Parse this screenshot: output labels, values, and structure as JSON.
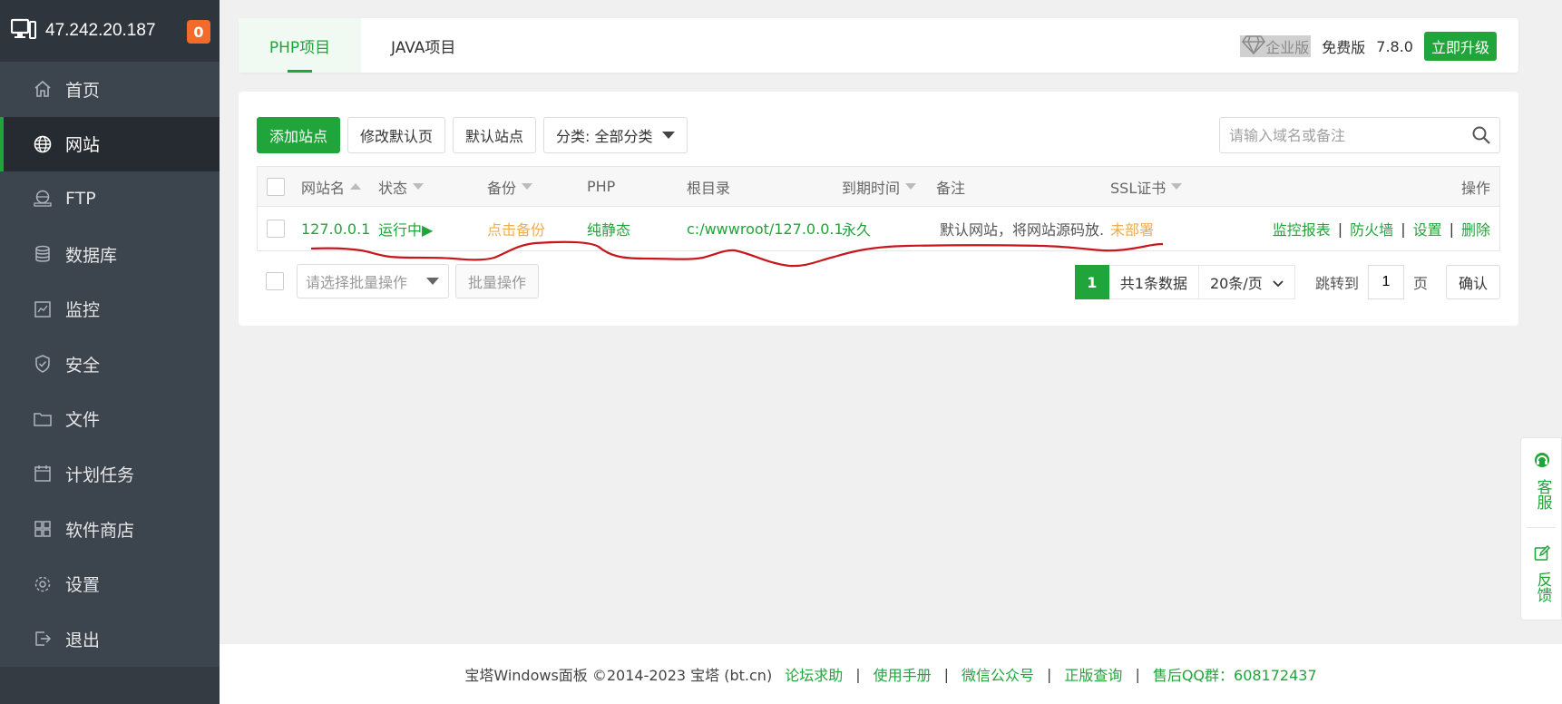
{
  "sidebar": {
    "ip": "47.242.20.187",
    "badge": "0",
    "items": [
      {
        "label": "首页",
        "icon": "home-icon"
      },
      {
        "label": "网站",
        "icon": "globe-icon"
      },
      {
        "label": "FTP",
        "icon": "ftp-icon"
      },
      {
        "label": "数据库",
        "icon": "database-icon"
      },
      {
        "label": "监控",
        "icon": "monitor-icon"
      },
      {
        "label": "安全",
        "icon": "shield-icon"
      },
      {
        "label": "文件",
        "icon": "folder-icon"
      },
      {
        "label": "计划任务",
        "icon": "calendar-icon"
      },
      {
        "label": "软件商店",
        "icon": "apps-icon"
      },
      {
        "label": "设置",
        "icon": "gear-icon"
      },
      {
        "label": "退出",
        "icon": "logout-icon"
      }
    ]
  },
  "topbar": {
    "tabs": [
      "PHP项目",
      "JAVA项目"
    ],
    "enterprise": "企业版",
    "edition": "免费版",
    "version": "7.8.0",
    "upgrade": "立即升级"
  },
  "toolbar": {
    "add_site": "添加站点",
    "edit_default": "修改默认页",
    "default_site": "默认站点",
    "category": "分类: 全部分类",
    "search_placeholder": "请输入域名或备注"
  },
  "table": {
    "headers": {
      "name": "网站名",
      "status": "状态",
      "backup": "备份",
      "php": "PHP",
      "root": "根目录",
      "expire": "到期时间",
      "remark": "备注",
      "ssl": "SSL证书",
      "ops": "操作"
    },
    "rows": [
      {
        "name": "127.0.0.1",
        "status": "运行中▶",
        "backup": "点击备份",
        "php": "纯静态",
        "root": "c:/wwwroot/127.0.0.1",
        "expire": "永久",
        "remark": "默认网站，将网站源码放.",
        "ssl": "未部署",
        "ops": [
          "监控报表",
          "防火墙",
          "设置",
          "删除"
        ]
      }
    ]
  },
  "batch": {
    "placeholder": "请选择批量操作",
    "button": "批量操作"
  },
  "pager": {
    "current": "1",
    "total": "共1条数据",
    "per_page": "20条/页",
    "jump_label": "跳转到",
    "jump_value": "1",
    "page_unit": "页",
    "confirm": "确认"
  },
  "float": {
    "service": "客服",
    "feedback": "反馈"
  },
  "footer": {
    "copyright": "宝塔Windows面板 ©2014-2023 宝塔 (bt.cn)",
    "links": [
      "论坛求助",
      "使用手册",
      "微信公众号",
      "正版查询",
      "售后QQ群：608172437"
    ]
  },
  "colors": {
    "accent": "#20a53a",
    "sidebar": "#3c444d",
    "warning": "#f0ad4e",
    "badge": "#f36b2b",
    "annotation": "#c8161d"
  }
}
